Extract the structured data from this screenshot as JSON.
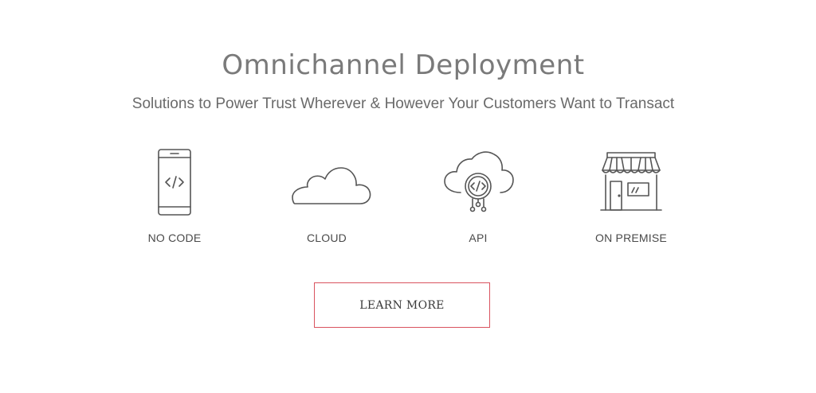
{
  "section": {
    "title": "Omnichannel Deployment",
    "subtitle": "Solutions to Power Trust Wherever & However Your Customers Want to Transact"
  },
  "features": [
    {
      "label": "NO CODE",
      "icon": "mobile-code-icon"
    },
    {
      "label": "CLOUD",
      "icon": "cloud-icon"
    },
    {
      "label": "API",
      "icon": "cloud-api-icon"
    },
    {
      "label": "ON PREMISE",
      "icon": "storefront-icon"
    }
  ],
  "cta": {
    "label": "LEARN MORE"
  },
  "colors": {
    "cta_border": "#d9535f",
    "icon_stroke": "#555555"
  }
}
